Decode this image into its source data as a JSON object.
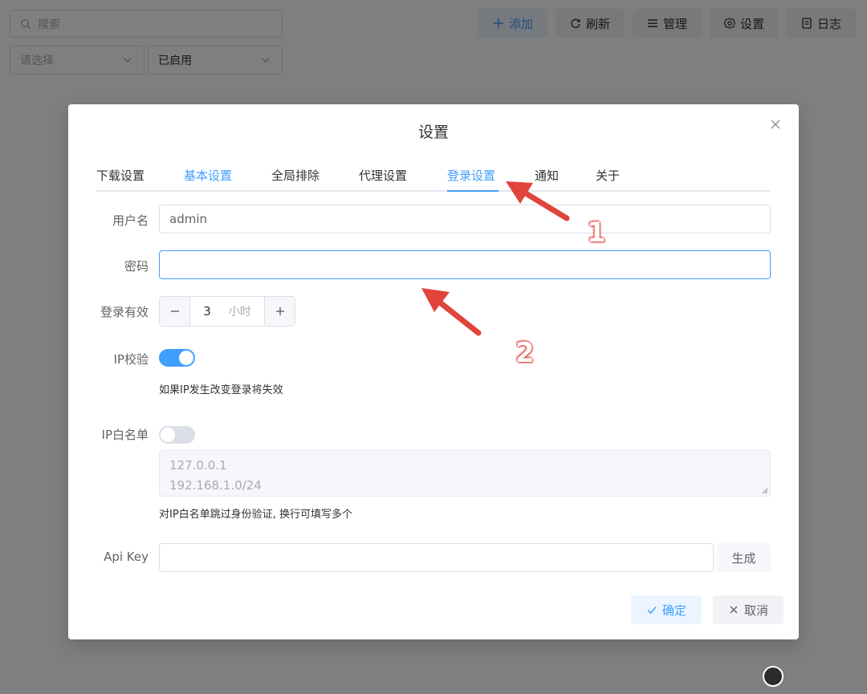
{
  "toolbar": {
    "search_placeholder": "搜索",
    "filter1_placeholder": "请选择",
    "filter2_value": "已启用",
    "add_label": "添加",
    "refresh_label": "刷新",
    "manage_label": "管理",
    "settings_label": "设置",
    "log_label": "日志"
  },
  "dialog": {
    "title": "设置",
    "tabs": [
      {
        "label": "下载设置"
      },
      {
        "label": "基本设置"
      },
      {
        "label": "全局排除"
      },
      {
        "label": "代理设置"
      },
      {
        "label": "登录设置"
      },
      {
        "label": "通知"
      },
      {
        "label": "关于"
      }
    ],
    "active_tab": "登录设置",
    "form": {
      "username_label": "用户名",
      "username_value": "admin",
      "password_label": "密码",
      "password_value": "",
      "login_valid_label": "登录有效",
      "login_valid_value": "3",
      "login_valid_unit": "小时",
      "ip_check_label": "IP校验",
      "ip_check_on": true,
      "ip_check_hint": "如果IP发生改变登录将失效",
      "ip_whitelist_label": "IP白名单",
      "ip_whitelist_on": false,
      "ip_whitelist_placeholder_line1": "127.0.0.1",
      "ip_whitelist_placeholder_line2": "192.168.1.0/24",
      "ip_whitelist_hint": "对IP白名单跳过身份验证, 换行可填写多个",
      "apikey_label": "Api Key",
      "apikey_value": "",
      "generate_label": "生成"
    },
    "confirm_label": "确定",
    "cancel_label": "取消"
  },
  "annotations": {
    "n1": "1",
    "n2": "2"
  },
  "colors": {
    "accent": "#409eff",
    "arrow": "#e0443a"
  }
}
